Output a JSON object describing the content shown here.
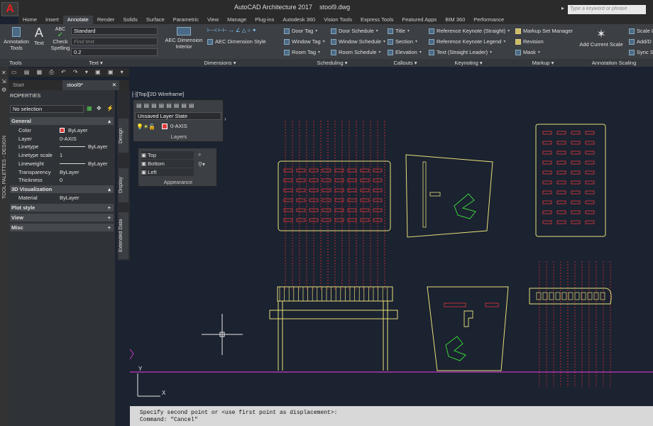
{
  "app": {
    "logo": "A",
    "title": "AutoCAD Architecture 2017",
    "file": "stool9.dwg",
    "search_placeholder": "Type a keyword or phrase"
  },
  "ribbon_tabs": [
    "Home",
    "Insert",
    "Annotate",
    "Render",
    "Solids",
    "Surface",
    "Parametric",
    "View",
    "Manage",
    "Plug-ins",
    "Autodesk 360",
    "Vision Tools",
    "Express Tools",
    "Featured Apps",
    "BIM 360",
    "Performance"
  ],
  "active_tab": "Annotate",
  "ribbon": {
    "annotation_tools": "Annotation Tools",
    "text_btn": "Text",
    "abc": "ABC",
    "check_spelling": "Check Spelling",
    "style_combo": "Standard",
    "find_placeholder": "Find text",
    "height_combo": "0.2",
    "aec_dim_interior": "AEC Dimension Interior",
    "aec_dim_style": "AEC Dimension Style",
    "door_tag": "Door Tag",
    "window_tag": "Window Tag",
    "room_tag": "Room Tag",
    "door_schedule": "Door Schedule",
    "window_schedule": "Window Schedule",
    "room_schedule": "Room Schedule",
    "title": "Title",
    "section": "Section",
    "elevation": "Elevation",
    "ref_keynote": "Reference Keynote (Straight)",
    "ref_keynote_legend": "Reference Keynote Legend",
    "text_straight_leader": "Text (Straight Leader)",
    "markup_set_manager": "Markup Set Manager",
    "revision": "Revision",
    "mask": "Mask",
    "add_current_scale": "Add Current Scale",
    "scale_list": "Scale L",
    "add_del": "Add/D",
    "sync_scale": "Sync S",
    "panels": {
      "tools": "Tools",
      "text": "Text",
      "dimensions": "Dimensions",
      "scheduling": "Scheduling",
      "callouts": "Callouts",
      "keynoting": "Keynoting",
      "markup": "Markup",
      "annotation_scaling": "Annotation Scaling"
    }
  },
  "doc_tabs": {
    "start": "Start",
    "active": "stool9*"
  },
  "tool_palettes_label": "TOOL PALETTES - DESIGN",
  "properties": {
    "header": "ROPERTIES",
    "selection": "No selection",
    "general": "General",
    "rows": [
      {
        "k": "Color",
        "v": "ByLayer"
      },
      {
        "k": "Layer",
        "v": "0-AXIS"
      },
      {
        "k": "Linetype",
        "v": "ByLayer"
      },
      {
        "k": "Linetype scale",
        "v": "1"
      },
      {
        "k": "Lineweight",
        "v": "ByLayer"
      },
      {
        "k": "Transparency",
        "v": "ByLayer"
      },
      {
        "k": "Thickness",
        "v": "0"
      }
    ],
    "viz": "3D Visualization",
    "material_k": "Material",
    "material_v": "ByLayer",
    "plot_style": "Plot style",
    "view": "View",
    "misc": "Misc"
  },
  "side_tabs": [
    "Design",
    "Display",
    "Extended Data"
  ],
  "viewport_label": "[-][Top][2D Wireframe]",
  "layers_palette": {
    "state": "Unsaved Layer State",
    "layer": "0-AXIS",
    "title": "Layers"
  },
  "appearance_palette": {
    "items": [
      "Top",
      "Bottom",
      "Left"
    ],
    "title": "Appearance"
  },
  "ucs": {
    "x": "X",
    "y": "Y"
  },
  "command_lines": [
    "Specify second point or <use first point as displacement>:",
    "Command: \"Cancel\""
  ],
  "colors": {
    "yellow": "#e7e07a",
    "red": "#e33a3a",
    "green": "#3bd23b",
    "magenta": "#c23ac2",
    "bg": "#1b2230"
  }
}
